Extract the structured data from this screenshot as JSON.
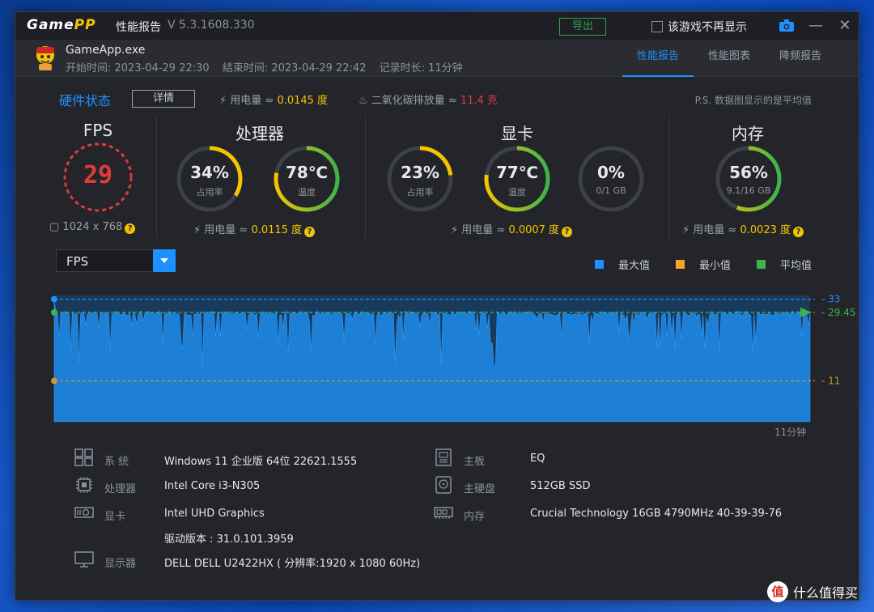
{
  "titlebar": {
    "logo_a": "Game",
    "logo_b": "PP",
    "title": "性能报告",
    "version": "V 5.3.1608.330",
    "export_label": "导出",
    "no_display_label": "该游戏不再显示",
    "minimize": "—",
    "close": "✕"
  },
  "header": {
    "exe": "GameApp.exe",
    "start_time": "开始时间: 2023-04-29 22:30",
    "end_time": "结束时间: 2023-04-29 22:42",
    "duration": "记录时长: 11分钟",
    "tabs": [
      {
        "label": "性能报告",
        "active": true
      },
      {
        "label": "性能图表",
        "active": false
      },
      {
        "label": "降频报告",
        "active": false
      }
    ]
  },
  "hw_status": {
    "title": "硬件状态",
    "detail_label": "详情",
    "power_prefix": "用电量 ≈ ",
    "power_value": "0.0145 度",
    "co2_prefix": "二氧化碳排放量 ≈ ",
    "co2_value": "11.4 克",
    "note": "P.S. 数据图显示的是平均值"
  },
  "fps": {
    "title": "FPS",
    "value": "29",
    "resolution": "1024 x 768"
  },
  "cpu": {
    "title": "处理器",
    "usage": {
      "value": "34%",
      "label": "占用率",
      "fraction": 0.34
    },
    "temp": {
      "value": "78℃",
      "label": "温度",
      "fraction": 0.78
    },
    "power_prefix": "用电量 ≈ ",
    "power_value": "0.0115 度"
  },
  "gpu": {
    "title": "显卡",
    "usage": {
      "value": "23%",
      "label": "占用率",
      "fraction": 0.23
    },
    "temp": {
      "value": "77℃",
      "label": "温度",
      "fraction": 0.77
    },
    "vram": {
      "value": "0%",
      "label": "0/1 GB",
      "fraction": 0.0
    },
    "power_prefix": "用电量 ≈ ",
    "power_value": "0.0007 度"
  },
  "mem": {
    "title": "内存",
    "usage": {
      "value": "56%",
      "label": "9.1/16 GB",
      "fraction": 0.56
    },
    "power_prefix": "用电量 ≈ ",
    "power_value": "0.0023 度"
  },
  "chart_controls": {
    "select_value": "FPS",
    "legend": [
      {
        "label": "最大值",
        "color": "#1e90ff"
      },
      {
        "label": "最小值",
        "color": "#f5a623"
      },
      {
        "label": "平均值",
        "color": "#3cb44b"
      }
    ],
    "time_label": "11分钟"
  },
  "chart_data": {
    "type": "area",
    "title": "",
    "xlabel": "",
    "ylabel": "",
    "duration_label": "11分钟",
    "max": 33,
    "min": 11,
    "avg": 29.45,
    "max_label": "33",
    "min_label": "11",
    "avg_label": "29.45",
    "ylim": [
      0,
      34
    ]
  },
  "system_info": {
    "os_label": "系  统",
    "os_value": "Windows 11 企业版 64位 22621.1555",
    "cpu_label": "处理器",
    "cpu_value": "Intel Core i3-N305",
    "gpu_label": "显卡",
    "gpu_value": "Intel UHD Graphics",
    "driver_value": "驱动版本 : 31.0.101.3959",
    "monitor_label": "显示器",
    "monitor_value": "DELL DELL U2422HX ( 分辨率:1920 x 1080 60Hz)",
    "board_label": "主板",
    "board_value": "EQ",
    "disk_label": "主硬盘",
    "disk_value": "512GB SSD",
    "ram_label": "内存",
    "ram_value": "Crucial Technology 16GB 4790MHz 40-39-39-76"
  },
  "watermark": {
    "circle": "值",
    "text": "什么值得买"
  },
  "colors": {
    "accent": "#1e90ff",
    "yellow": "#f5c400",
    "red": "#e03b3b",
    "green": "#3cb44b"
  }
}
